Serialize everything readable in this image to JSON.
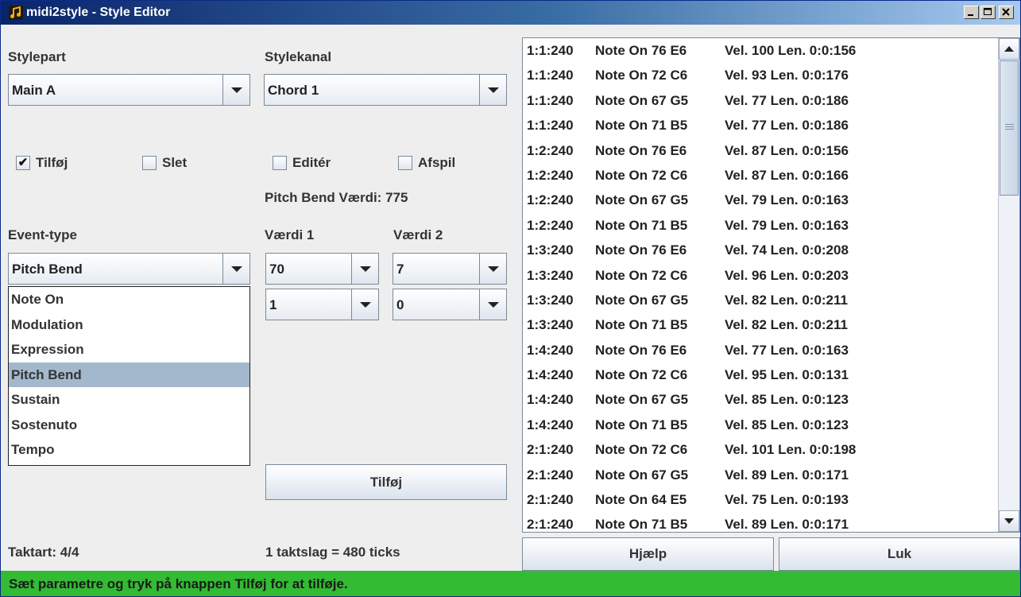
{
  "window": {
    "title": "midi2style - Style Editor",
    "controls": {
      "minimize": "_",
      "maximize": "□",
      "close": "×"
    }
  },
  "left": {
    "stylepart_label": "Stylepart",
    "stylepart_value": "Main A",
    "stylekanal_label": "Stylekanal",
    "stylekanal_value": "Chord 1",
    "checkboxes": [
      {
        "label": "Tilføj",
        "checked": true
      },
      {
        "label": "Slet",
        "checked": false
      },
      {
        "label": "Editér",
        "checked": false
      },
      {
        "label": "Afspil",
        "checked": false
      }
    ],
    "checkmark": "✔",
    "pitch_bend_info": "Pitch Bend Værdi: 775",
    "eventtype_label": "Event-type",
    "eventtype_value": "Pitch Bend",
    "vaerdi1_label": "Værdi 1",
    "vaerdi2_label": "Værdi 2",
    "vaerdi1_a": "70",
    "vaerdi2_a": "7",
    "vaerdi1_b": "1",
    "vaerdi2_b": "0",
    "eventtype_options": [
      "Note On",
      "Modulation",
      "Expression",
      "Pitch Bend",
      "Sustain",
      "Sostenuto",
      "Tempo"
    ],
    "eventtype_selected_index": 3,
    "add_button": "Tilføj",
    "taktart": "Taktart: 4/4",
    "ticks_info": "1 taktslag = 480 ticks"
  },
  "events": [
    [
      "1:1:240",
      "Note On 76 E6",
      "Vel. 100  Len. 0:0:156"
    ],
    [
      "1:1:240",
      "Note On 72 C6",
      "Vel. 93  Len. 0:0:176"
    ],
    [
      "1:1:240",
      "Note On 67 G5",
      "Vel. 77  Len. 0:0:186"
    ],
    [
      "1:1:240",
      "Note On 71 B5",
      "Vel. 77  Len. 0:0:186"
    ],
    [
      "1:2:240",
      "Note On 76 E6",
      "Vel. 87  Len. 0:0:156"
    ],
    [
      "1:2:240",
      "Note On 72 C6",
      "Vel. 87  Len. 0:0:166"
    ],
    [
      "1:2:240",
      "Note On 67 G5",
      "Vel. 79  Len. 0:0:163"
    ],
    [
      "1:2:240",
      "Note On 71 B5",
      "Vel. 79  Len. 0:0:163"
    ],
    [
      "1:3:240",
      "Note On 76 E6",
      "Vel. 74  Len. 0:0:208"
    ],
    [
      "1:3:240",
      "Note On 72 C6",
      "Vel. 96  Len. 0:0:203"
    ],
    [
      "1:3:240",
      "Note On 67 G5",
      "Vel. 82  Len. 0:0:211"
    ],
    [
      "1:3:240",
      "Note On 71 B5",
      "Vel. 82  Len. 0:0:211"
    ],
    [
      "1:4:240",
      "Note On 76 E6",
      "Vel. 77  Len. 0:0:163"
    ],
    [
      "1:4:240",
      "Note On 72 C6",
      "Vel. 95  Len. 0:0:131"
    ],
    [
      "1:4:240",
      "Note On 67 G5",
      "Vel. 85  Len. 0:0:123"
    ],
    [
      "1:4:240",
      "Note On 71 B5",
      "Vel. 85  Len. 0:0:123"
    ],
    [
      "2:1:240",
      "Note On 72 C6",
      "Vel. 101  Len. 0:0:198"
    ],
    [
      "2:1:240",
      "Note On 67 G5",
      "Vel. 89  Len. 0:0:171"
    ],
    [
      "2:1:240",
      "Note On 64 E5",
      "Vel. 75  Len. 0:0:193"
    ],
    [
      "2:1:240",
      "Note On 71 B5",
      "Vel. 89  Len. 0:0:171"
    ]
  ],
  "buttons": {
    "help": "Hjælp",
    "close": "Luk"
  },
  "status": "Sæt parametre og tryk på knappen Tilføj for at tilføje.",
  "colors": {
    "status_bg": "#33bb33",
    "selection": "#a3b8cc",
    "title_start": "#0a246a",
    "title_end": "#a6caf0"
  }
}
